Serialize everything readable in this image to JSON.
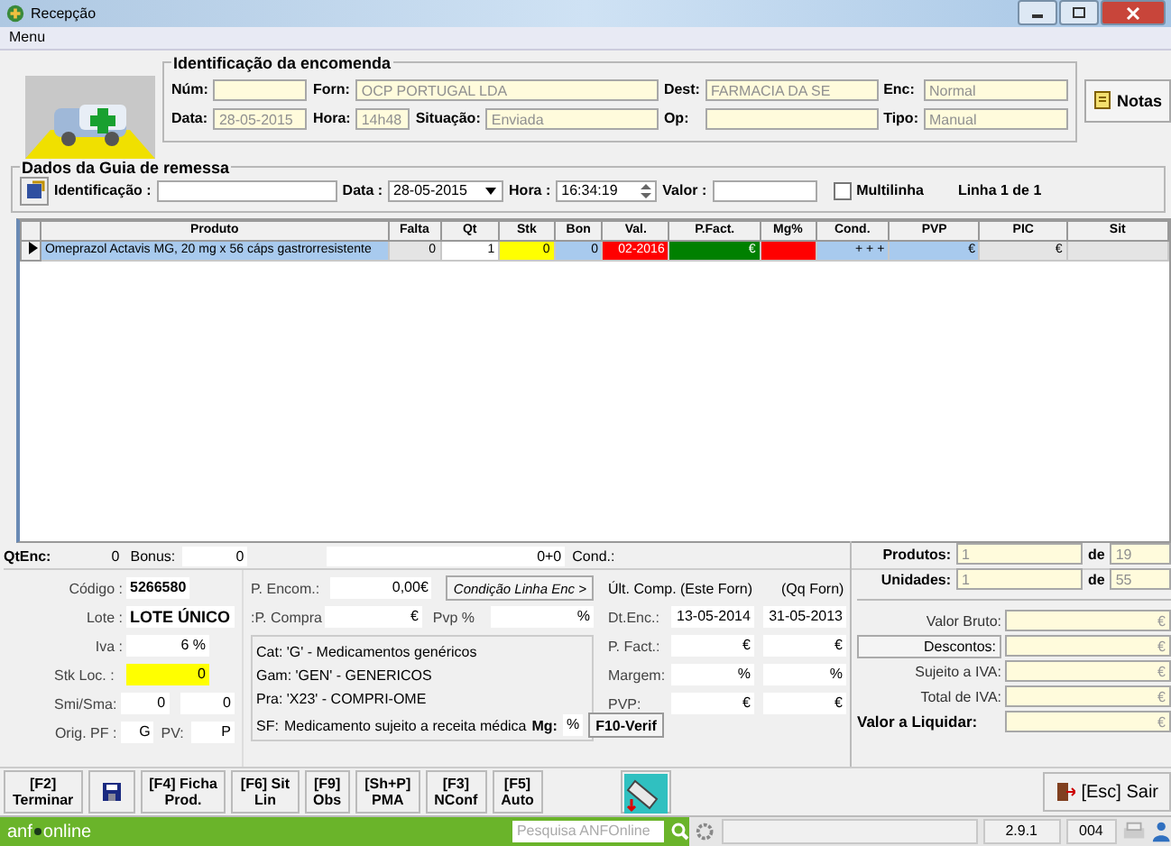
{
  "window": {
    "title": "Recepção",
    "menu": "Menu"
  },
  "order": {
    "heading": "Identificação da encomenda",
    "fields": [
      {
        "label": "Núm:"
      },
      {
        "label": "Forn:",
        "value": "OCP PORTUGAL LDA"
      },
      {
        "label": "Dest:",
        "value": "FARMACIA DA SE"
      },
      {
        "label": "Enc:",
        "value": "Normal"
      },
      {
        "label": "Data:",
        "value": "28-05-2015"
      },
      {
        "label": "Hora:",
        "value": "14h48"
      },
      {
        "label": "Situação:",
        "value": "Enviada"
      },
      {
        "label": "Op:"
      },
      {
        "label": "Tipo:",
        "value": "Manual"
      }
    ],
    "notes_button": "Notas"
  },
  "guia": {
    "heading": "Dados da Guia de remessa",
    "id_label": "Identificação :",
    "date_label": "Data :",
    "date": "28-05-2015",
    "time_label": "Hora :",
    "time": "16:34:19",
    "value_label": "Valor :",
    "multiline": {
      "label": "Multilinha",
      "checked": false
    },
    "line": "Linha 1 de 1"
  },
  "table": {
    "columns": [
      "Produto",
      "Falta",
      "Qt",
      "Stk",
      "Bon",
      "Val.",
      "P.Fact.",
      "Mg%",
      "Cond.",
      "PVP",
      "PIC",
      "Sit"
    ],
    "rows": [
      {
        "selected": true,
        "cells": [
          {
            "text": "Omeprazol Actavis MG, 20 mg x 56 cáps gastrorresistente",
            "color": "#a8caee"
          },
          {
            "text": "0",
            "color": "#e4e4e4"
          },
          {
            "text": "1",
            "color": "#ffffff"
          },
          {
            "text": "0",
            "color": "#ffff00"
          },
          {
            "text": "0",
            "color": "#a8caee"
          },
          {
            "text": "02-2016",
            "color": "#ff0000"
          },
          {
            "text": "€",
            "color": "#008000"
          },
          {
            "color": "#ff0000"
          },
          {
            "text": "+ + +",
            "color": "#a8caee"
          },
          {
            "text": "€",
            "color": "#a8caee"
          },
          {
            "text": "€",
            "color": "#e4e4e4"
          },
          {
            "color": "#e4e4e4"
          }
        ]
      }
    ]
  },
  "summary": {
    "qtenc_label": "QtEnc:",
    "qtenc": "0",
    "bonus_label": "Bonus:",
    "bonus": "0",
    "sum": "0+0",
    "cond_label": "Cond.:",
    "counters": [
      {
        "label": "Produtos:",
        "value": "1",
        "of": "de",
        "total": "19"
      },
      {
        "label": "Unidades:",
        "value": "1",
        "of": "de",
        "total": "55"
      }
    ]
  },
  "product": {
    "codigo_label": "Código :",
    "codigo": "5266580",
    "lote_label": "Lote :",
    "lote": "LOTE ÚNICO",
    "iva_label": "Iva :",
    "iva": "6 %",
    "stk_label": "Stk Loc. :",
    "stk": "0",
    "smi_label": "Smi/Sma:",
    "smi": "0",
    "sma": "0",
    "orig_label": "Orig. PF :",
    "orig": "G",
    "pv_label": "PV:",
    "pv": "P"
  },
  "prices": {
    "encom_label": "P. Encom.:",
    "encom": "0,00€",
    "compra_label": ":P. Compra",
    "compra": "€",
    "pvp_label": "Pvp %",
    "pvp": "%",
    "condition_button": "Condição Linha Enc >",
    "cat": "Cat: 'G' - Medicamentos genéricos",
    "gam": "Gam: 'GEN' - GENERICOS",
    "pra": "Pra: 'X23' - COMPRI-OME",
    "sf_label": "SF:",
    "sf": "Medicamento sujeito a receita médica",
    "mg_label": "Mg:",
    "mg": "%"
  },
  "last": {
    "title": "Últ. Comp. (Este Forn)",
    "title2": "(Qq Forn)",
    "rows": [
      {
        "label": "Dt.Enc.:",
        "a": "13-05-2014",
        "b": "31-05-2013"
      },
      {
        "label": "P. Fact.:",
        "a": "€",
        "b": "€"
      },
      {
        "label": "Margem:",
        "a": "%",
        "b": "%"
      },
      {
        "label": "PVP:",
        "a": "€",
        "b": "€"
      }
    ],
    "verify_button": "F10-Verif"
  },
  "totals": [
    {
      "label": "Valor Bruto:",
      "value": "€",
      "kind": "text"
    },
    {
      "label": "Descontos:",
      "value": "€",
      "kind": "button"
    },
    {
      "label": "Sujeito a IVA:",
      "value": "€",
      "kind": "text"
    },
    {
      "label": "Total de IVA:",
      "value": "€",
      "kind": "text"
    },
    {
      "label": "Valor a Liquidar:",
      "value": "€",
      "kind": "bold"
    }
  ],
  "actions": [
    {
      "key": "[F2]",
      "label": "Terminar",
      "kind": "text"
    },
    {
      "kind": "save"
    },
    {
      "key": "[F4] Ficha",
      "label": "Prod.",
      "kind": "text"
    },
    {
      "key": "[F6] Sit",
      "label": "Lin",
      "kind": "text"
    },
    {
      "key": "[F9]",
      "label": "Obs",
      "kind": "text"
    },
    {
      "key": "[Sh+P]",
      "label": "PMA",
      "kind": "text"
    },
    {
      "key": "[F3]",
      "label": "NConf",
      "kind": "text"
    },
    {
      "key": "[F5]",
      "label": "Auto",
      "kind": "text"
    },
    {
      "kind": "device"
    }
  ],
  "exit_button": "[Esc] Sair",
  "status_bar": {
    "logo_a": "anf",
    "logo_b": "online",
    "search_placeholder": "Pesquisa ANFOnline",
    "version": "2.9.1",
    "code": "004"
  }
}
